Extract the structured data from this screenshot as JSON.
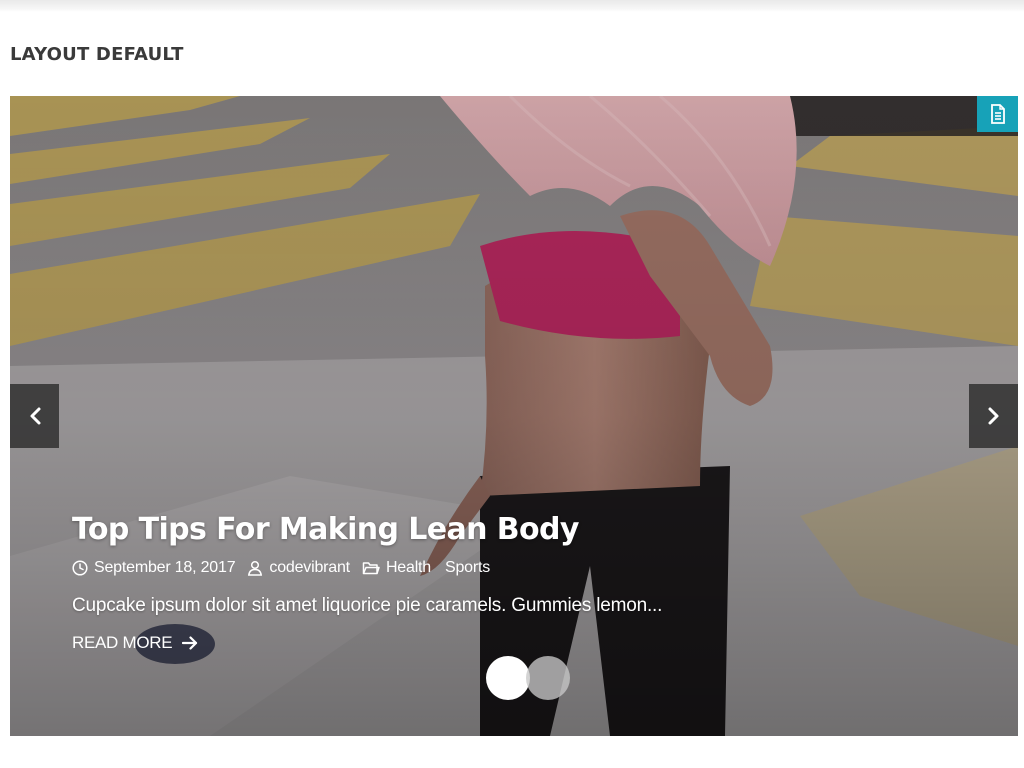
{
  "section": {
    "title": "LAYOUT DEFAULT"
  },
  "slide": {
    "title": "Top Tips For Making Lean Body",
    "date": "September 18, 2017",
    "author": "codevibrant",
    "categories": [
      "Health",
      "Sports"
    ],
    "excerpt": "Cupcake ipsum dolor sit amet liquorice pie caramels. Gummies lemon...",
    "read_more": "READ MORE"
  },
  "icons": {
    "format": "document-icon",
    "prev": "chevron-left-icon",
    "next": "chevron-right-icon",
    "date": "clock-icon",
    "author": "user-icon",
    "category": "folder-icon",
    "read_more": "arrow-right-icon"
  },
  "colors": {
    "accent": "#17a2b8",
    "title_text": "#3a3a3a"
  },
  "pagination": {
    "total": 2,
    "active": 1
  }
}
